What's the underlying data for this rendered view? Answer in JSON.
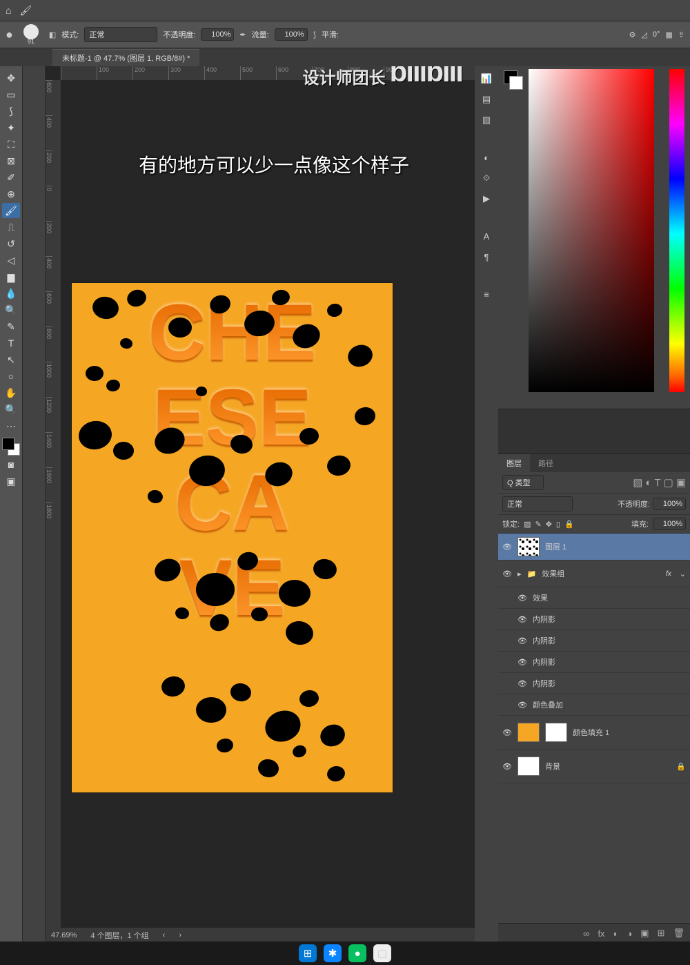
{
  "optionsBar": {
    "brushSize": "91",
    "modeLabel": "模式:",
    "modeValue": "正常",
    "opacityLabel": "不透明度:",
    "opacityValue": "100%",
    "flowLabel": "流量:",
    "flowValue": "100%",
    "smoothLabel": "平滑:",
    "angleValue": "0°"
  },
  "docTab": "未标题-1 @ 47.7% (图层 1, RGB/8#) *",
  "subtitle": "有的地方可以少一点像这个样子",
  "watermark": "设计师团长",
  "bilibili": "bilibili",
  "artwork": {
    "line1": "CHE",
    "line2": "ESE",
    "line3": "CA",
    "line4": "VE"
  },
  "rulerH": [
    "",
    "100",
    "200",
    "300",
    "400",
    "500",
    "600",
    "700",
    "800",
    "900"
  ],
  "rulerV": [
    "600",
    "400",
    "200",
    "0",
    "200",
    "400",
    "600",
    "800",
    "1000",
    "1200",
    "1400",
    "1600",
    "1800"
  ],
  "statusBar": {
    "zoom": "47.69%",
    "info": "4 个图层，1 个组"
  },
  "panels": {
    "layersTab": "图层",
    "pathsTab": "路径",
    "filterPrefix": "Q 类型",
    "blendMode": "正常",
    "opLabel": "不透明度:",
    "opVal": "100%",
    "lockLabel": "锁定:",
    "fillLabel": "填充:",
    "fillVal": "100%",
    "layer1": "图层 1",
    "fxGroup": "效果组",
    "fxLabel": "效果",
    "innerShadow": "内阴影",
    "colorOverlay": "颜色叠加",
    "colorFill": "颜色填充 1",
    "background": "背景",
    "fx": "fx"
  },
  "footIcons": [
    "∞",
    "fx",
    "◐",
    "◑",
    "▣",
    "⊞",
    "🗑"
  ]
}
